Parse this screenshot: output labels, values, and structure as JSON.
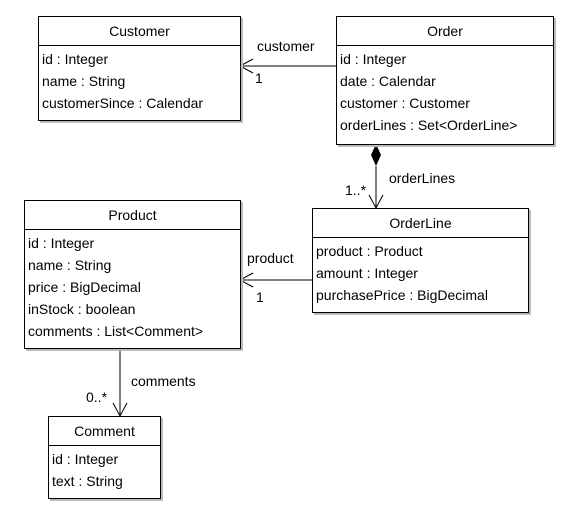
{
  "classes": [
    {
      "name": "Customer",
      "attributes": [
        "id : Integer",
        "name : String",
        "customerSince : Calendar"
      ]
    },
    {
      "name": "Order",
      "attributes": [
        "id : Integer",
        "date : Calendar",
        "customer : Customer",
        "orderLines : Set<OrderLine>"
      ]
    },
    {
      "name": "OrderLine",
      "attributes": [
        "product : Product",
        "amount : Integer",
        "purchasePrice : BigDecimal"
      ]
    },
    {
      "name": "Product",
      "attributes": [
        "id : Integer",
        "name : String",
        "price : BigDecimal",
        "inStock : boolean",
        "comments : List<Comment>"
      ]
    },
    {
      "name": "Comment",
      "attributes": [
        "id : Integer",
        "text : String"
      ]
    }
  ],
  "associations": [
    {
      "from": "Order",
      "to": "Customer",
      "role": "customer",
      "multiplicity": "1",
      "kind": "navigable"
    },
    {
      "from": "Order",
      "to": "OrderLine",
      "role": "orderLines",
      "multiplicity": "1..*",
      "kind": "composition"
    },
    {
      "from": "OrderLine",
      "to": "Product",
      "role": "product",
      "multiplicity": "1",
      "kind": "navigable"
    },
    {
      "from": "Product",
      "to": "Comment",
      "role": "comments",
      "multiplicity": "0..*",
      "kind": "navigable"
    }
  ]
}
